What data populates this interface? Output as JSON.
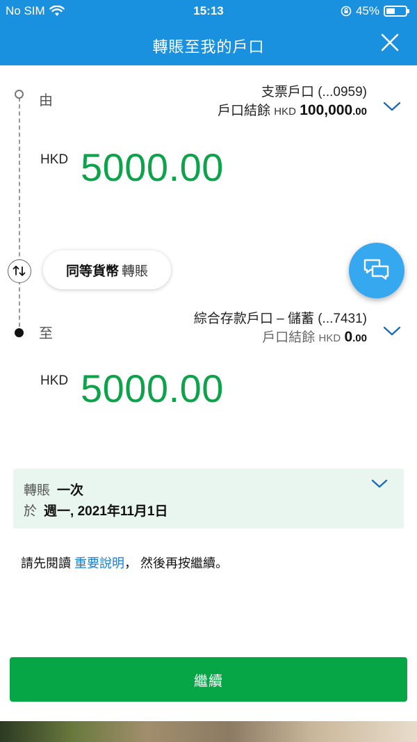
{
  "status_bar": {
    "carrier": "No SIM",
    "time": "15:13",
    "battery_percent": "45%",
    "battery_level": 0.45
  },
  "header": {
    "title": "轉賬至我的戶口",
    "close_icon": "close-icon"
  },
  "from": {
    "label": "由",
    "account_name": "支票戶口 (...0959)",
    "balance_label": "戶口結餘",
    "balance_currency": "HKD",
    "balance_integer": "100,000",
    "balance_decimal": ".00",
    "amount_currency": "HKD",
    "amount": "5000.00"
  },
  "transfer_type": {
    "bold": "同等貨幣",
    "regular": "轉賬"
  },
  "to": {
    "label": "至",
    "account_name": "綜合存款戶口 – 儲蓄 (...7431)",
    "balance_label": "戶口結餘",
    "balance_currency": "HKD",
    "balance_integer": "0",
    "balance_decimal": ".00",
    "amount_currency": "HKD",
    "amount": "5000.00"
  },
  "schedule": {
    "frequency_label": "轉賬",
    "frequency_value": "一次",
    "date_label": "於",
    "date_value": "週一, 2021年11月1日"
  },
  "notice": {
    "prefix": "請先閱讀",
    "link": "重要說明",
    "suffix": "， 然後再按繼續。"
  },
  "continue_label": "繼續",
  "colors": {
    "header": "#1a91de",
    "amount": "#0ea24b",
    "button": "#06a546",
    "chat": "#36a8f0",
    "link": "#1a7fd0"
  }
}
